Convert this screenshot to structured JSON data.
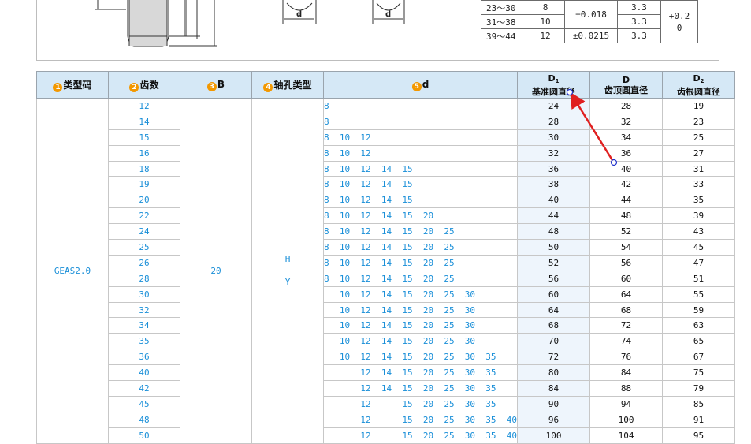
{
  "top_table": [
    {
      "range": "23～30",
      "n": "8",
      "tol": "±0.018",
      "v": "3.3",
      "tol2": "+0.2"
    },
    {
      "range": "31～38",
      "n": "10",
      "v": "3.3",
      "tol2b": "0"
    },
    {
      "range": "39～44",
      "n": "12",
      "tol": "±0.0215",
      "v": "3.3"
    }
  ],
  "drawing": {
    "label_d1": "d",
    "label_d2": "d"
  },
  "headers": {
    "h1_num": "1",
    "h1": "类型码",
    "h2_num": "2",
    "h2": "齿数",
    "h3_num": "3",
    "h3": "B",
    "h4_num": "4",
    "h4": "轴孔类型",
    "h5_num": "5",
    "h5": "d",
    "h6_sym": "D",
    "h6_sub": "1",
    "h6": "基准圆直径",
    "h7_sym": "D",
    "h7": "齿顶圆直径",
    "h8_sym": "D",
    "h8_sub": "2",
    "h8": "齿根圆直径"
  },
  "type_code": "GEAS2.0",
  "b_value": "20",
  "hole_types": [
    "H",
    "Y"
  ],
  "rows": [
    {
      "z": "12",
      "d": "8",
      "d1": "24",
      "dd": "28",
      "d2": "19"
    },
    {
      "z": "14",
      "d": "8",
      "d1": "28",
      "dd": "32",
      "d2": "23"
    },
    {
      "z": "15",
      "d": "8  10  12",
      "d1": "30",
      "dd": "34",
      "d2": "25"
    },
    {
      "z": "16",
      "d": "8  10  12",
      "d1": "32",
      "dd": "36",
      "d2": "27"
    },
    {
      "z": "18",
      "d": "8  10  12  14  15",
      "d1": "36",
      "dd": "40",
      "d2": "31"
    },
    {
      "z": "19",
      "d": "8  10  12  14  15",
      "d1": "38",
      "dd": "42",
      "d2": "33"
    },
    {
      "z": "20",
      "d": "8  10  12  14  15",
      "d1": "40",
      "dd": "44",
      "d2": "35"
    },
    {
      "z": "22",
      "d": "8  10  12  14  15  20",
      "d1": "44",
      "dd": "48",
      "d2": "39"
    },
    {
      "z": "24",
      "d": "8  10  12  14  15  20  25",
      "d1": "48",
      "dd": "52",
      "d2": "43"
    },
    {
      "z": "25",
      "d": "8  10  12  14  15  20  25",
      "d1": "50",
      "dd": "54",
      "d2": "45"
    },
    {
      "z": "26",
      "d": "8  10  12  14  15  20  25",
      "d1": "52",
      "dd": "56",
      "d2": "47"
    },
    {
      "z": "28",
      "d": "8  10  12  14  15  20  25",
      "d1": "56",
      "dd": "60",
      "d2": "51"
    },
    {
      "z": "30",
      "d": "   10  12  14  15  20  25  30",
      "d1": "60",
      "dd": "64",
      "d2": "55"
    },
    {
      "z": "32",
      "d": "   10  12  14  15  20  25  30",
      "d1": "64",
      "dd": "68",
      "d2": "59"
    },
    {
      "z": "34",
      "d": "   10  12  14  15  20  25  30",
      "d1": "68",
      "dd": "72",
      "d2": "63"
    },
    {
      "z": "35",
      "d": "   10  12  14  15  20  25  30",
      "d1": "70",
      "dd": "74",
      "d2": "65"
    },
    {
      "z": "36",
      "d": "   10  12  14  15  20  25  30  35",
      "d1": "72",
      "dd": "76",
      "d2": "67"
    },
    {
      "z": "40",
      "d": "       12  14  15  20  25  30  35",
      "d1": "80",
      "dd": "84",
      "d2": "75"
    },
    {
      "z": "42",
      "d": "       12  14  15  20  25  30  35",
      "d1": "84",
      "dd": "88",
      "d2": "79"
    },
    {
      "z": "45",
      "d": "       12      15  20  25  30  35",
      "d1": "90",
      "dd": "94",
      "d2": "85"
    },
    {
      "z": "48",
      "d": "       12      15  20  25  30  35  40",
      "d1": "96",
      "dd": "100",
      "d2": "91"
    },
    {
      "z": "50",
      "d": "       12      15  20  25  30  35  40",
      "d1": "100",
      "dd": "104",
      "d2": "95"
    }
  ],
  "colors": {
    "header_bg": "#d5e8f6",
    "accent_blue": "#1a8fd8",
    "badge_orange": "#f39800",
    "annotation_red": "#e02020"
  }
}
